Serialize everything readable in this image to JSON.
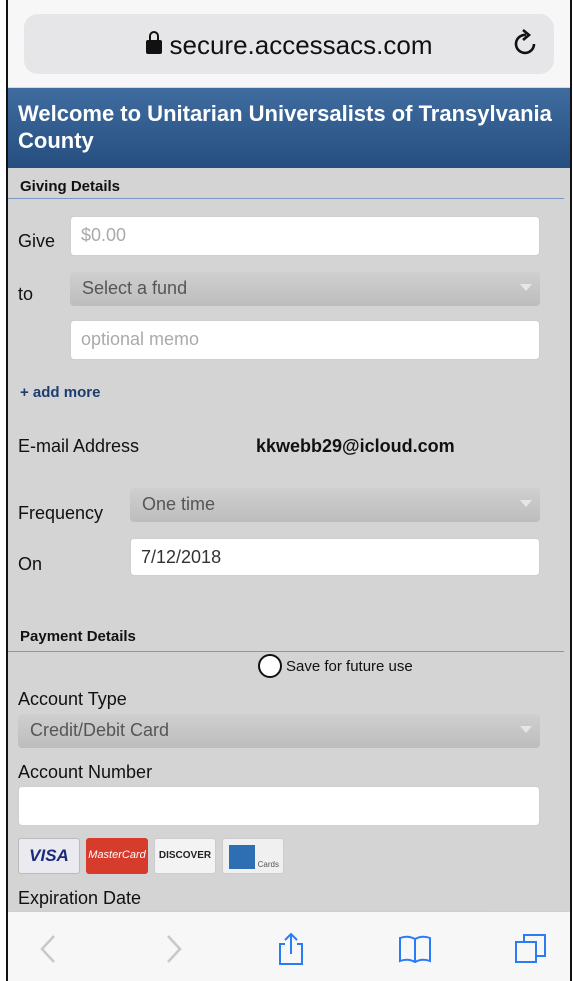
{
  "browser": {
    "url": "secure.accessacs.com"
  },
  "header": {
    "title": "Welcome to Unitarian Universalists of Transylvania County"
  },
  "giving": {
    "section_title": "Giving Details",
    "give_label": "Give",
    "amount_placeholder": "$0.00",
    "to_label": "to",
    "fund_selected": "Select a fund",
    "memo_placeholder": "optional memo",
    "add_more": "+ add more",
    "email_label": "E-mail Address",
    "email_value": "kkwebb29@icloud.com",
    "frequency_label": "Frequency",
    "frequency_selected": "One time",
    "on_label": "On",
    "date_value": "7/12/2018"
  },
  "payment": {
    "section_title": "Payment Details",
    "save_label": "Save for future use",
    "account_type_label": "Account Type",
    "account_type_selected": "Credit/Debit Card",
    "account_number_label": "Account Number",
    "cards": [
      "VISA",
      "MasterCard",
      "DISCOVER",
      "Cards"
    ],
    "expiration_label": "Expiration Date"
  },
  "toolbar": {
    "icons": [
      "back-icon",
      "forward-icon",
      "share-icon",
      "bookmarks-icon",
      "tabs-icon"
    ]
  },
  "colors": {
    "header": "#2f5b8e",
    "link": "#1d3d6f",
    "page_bg": "#d4d4d4"
  }
}
